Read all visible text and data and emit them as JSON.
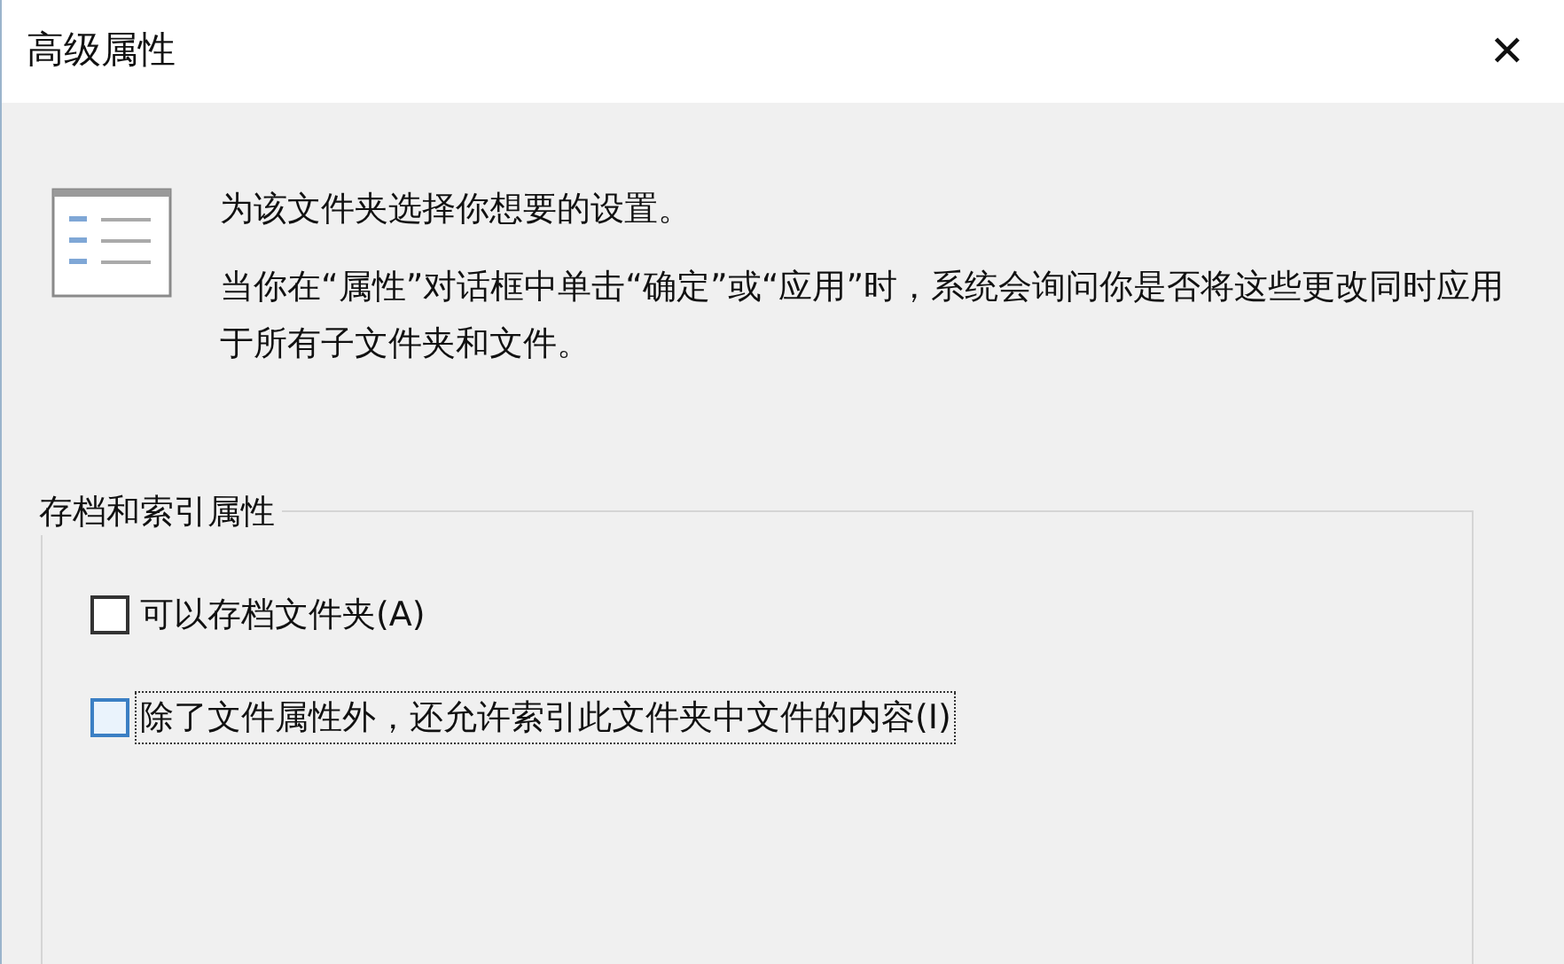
{
  "window": {
    "title": "高级属性",
    "close": "✕"
  },
  "intro": {
    "heading": "为该文件夹选择你想要的设置。",
    "body": "当你在“属性”对话框中单击“确定”或“应用”时，系统会询问你是否将这些更改同时应用于所有子文件夹和文件。"
  },
  "group": {
    "title": "存档和索引属性",
    "options": [
      {
        "label": "可以存档文件夹(A)",
        "checked": false,
        "focused": false
      },
      {
        "label": "除了文件属性外，还允许索引此文件夹中文件的内容(I)",
        "checked": false,
        "focused": true
      }
    ]
  }
}
